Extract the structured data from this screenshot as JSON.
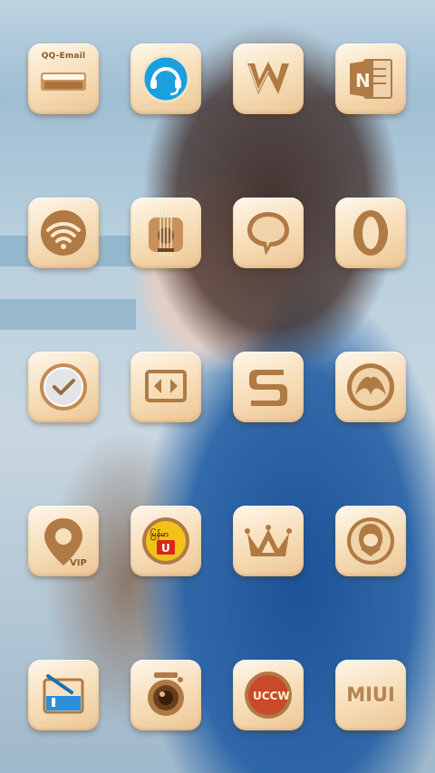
{
  "homescreen": {
    "wallpaper": "photo-of-woman-blue-top",
    "accent": "#f3d6ad",
    "rows": [
      [
        {
          "id": "qq-email",
          "label": "QQ-Email",
          "icon": "mail-tray-icon"
        },
        {
          "id": "headset",
          "label": "",
          "icon": "headset-icon"
        },
        {
          "id": "wps",
          "label": "W",
          "icon": "wps-office-icon"
        },
        {
          "id": "onenote",
          "label": "N",
          "icon": "onenote-icon"
        }
      ],
      [
        {
          "id": "wifi",
          "label": "",
          "icon": "wifi-icon"
        },
        {
          "id": "guitar",
          "label": "",
          "icon": "guitar-icon"
        },
        {
          "id": "chat",
          "label": "",
          "icon": "chat-bubble-icon"
        },
        {
          "id": "opera",
          "label": "",
          "icon": "opera-icon"
        }
      ],
      [
        {
          "id": "check",
          "label": "",
          "icon": "checkmark-icon"
        },
        {
          "id": "screen-mirror",
          "label": "",
          "icon": "screen-cast-icon"
        },
        {
          "id": "s-app",
          "label": "S",
          "icon": "s-letter-icon"
        },
        {
          "id": "round-app",
          "label": "",
          "icon": "round-logo-icon"
        }
      ],
      [
        {
          "id": "vip-player",
          "label": "VIP",
          "icon": "vip-location-icon"
        },
        {
          "id": "myanmar-unicode",
          "label": "မြန်မာ",
          "badge": "U",
          "icon": "myanmar-unicode-icon"
        },
        {
          "id": "crown",
          "label": "",
          "icon": "crown-icon"
        },
        {
          "id": "qq",
          "label": "",
          "icon": "qq-penguin-icon"
        }
      ],
      [
        {
          "id": "file-box",
          "label": "",
          "icon": "water-box-icon"
        },
        {
          "id": "camera",
          "label": "",
          "icon": "camera-icon"
        },
        {
          "id": "uccw",
          "label": "UCCW",
          "icon": "uccw-icon"
        },
        {
          "id": "miui",
          "label": "MIUI",
          "icon": "miui-icon"
        }
      ]
    ]
  }
}
